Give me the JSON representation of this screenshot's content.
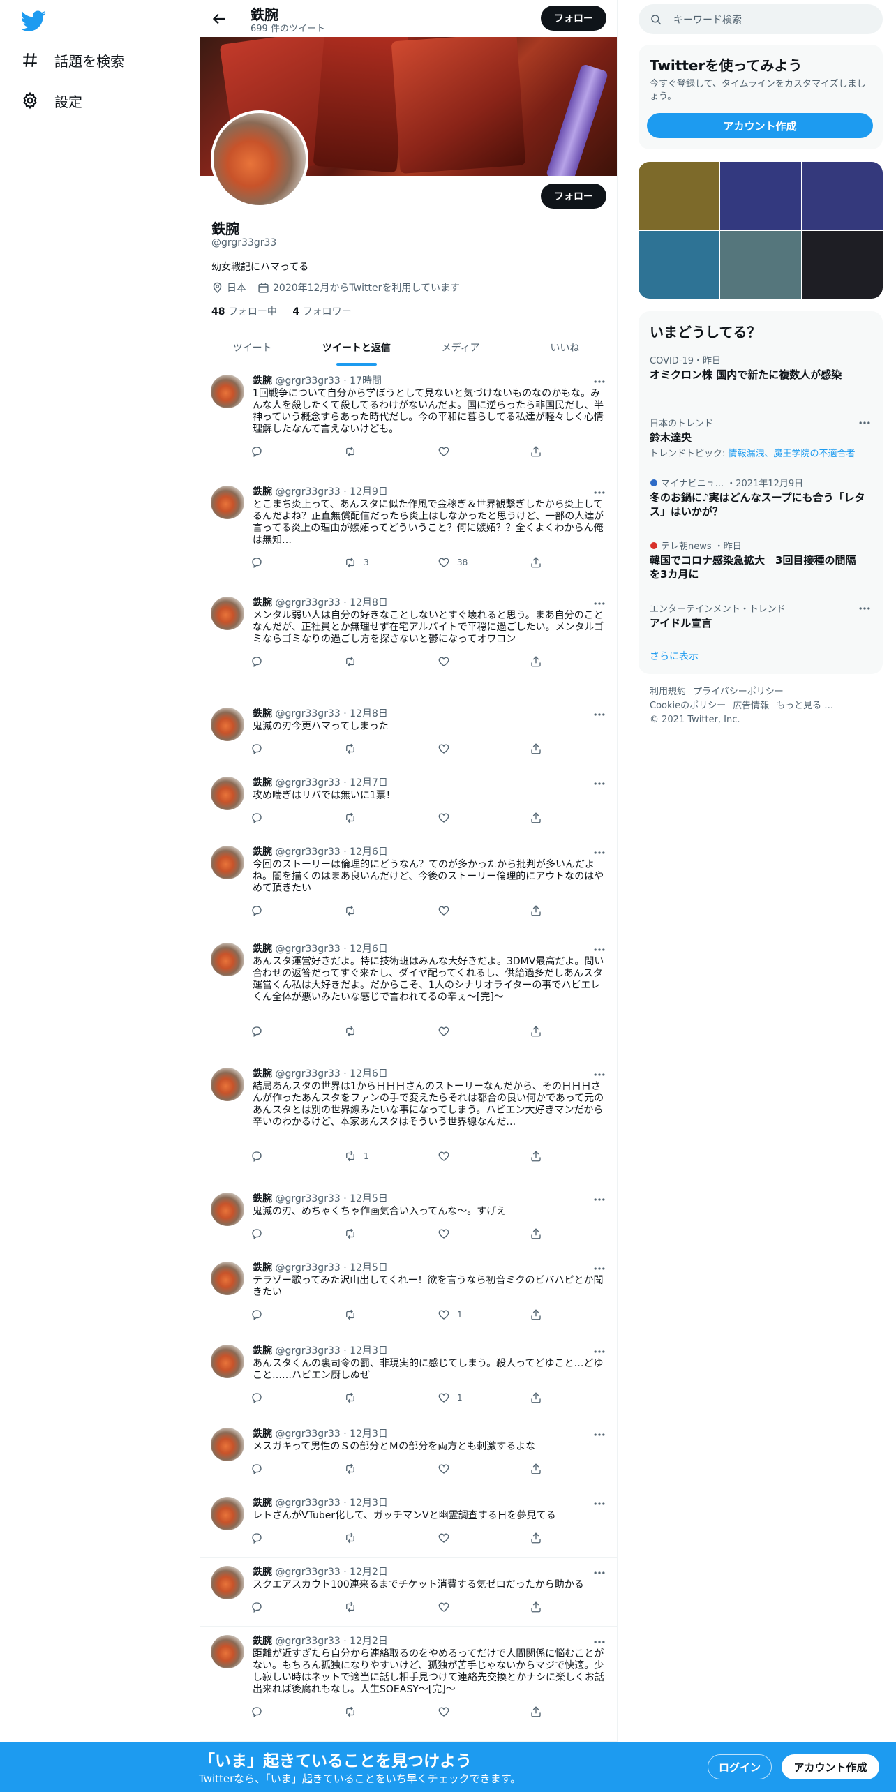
{
  "nav": {
    "items": [
      {
        "label": "話題を検索",
        "icon": "hashtag-icon"
      },
      {
        "label": "設定",
        "icon": "gear-icon"
      }
    ]
  },
  "header": {
    "title": "鉄腕",
    "tweet_count": "699 件のツイート",
    "follow_label": "フォロー"
  },
  "profile": {
    "name": "鉄腕",
    "handle": "@grgr33gr33",
    "bio": "幼女戦記にハマってる",
    "location": "日本",
    "joined": "2020年12月からTwitterを利用しています",
    "following_count": "48",
    "following_label": "フォロー中",
    "followers_count": "4",
    "followers_label": "フォロワー",
    "follow_label": "フォロー"
  },
  "tabs": [
    {
      "label": "ツイート",
      "active": false
    },
    {
      "label": "ツイートと返信",
      "active": true
    },
    {
      "label": "メディア",
      "active": false
    },
    {
      "label": "いいね",
      "active": false
    }
  ],
  "tweets": [
    {
      "name": "鉄腕",
      "handle": "@grgr33gr33",
      "time": "17時間",
      "text": "1回戦争について自分から学ぼうとして見ないと気づけないものなのかもな。みんな人を殺したくて殺してるわけがないんだよ。国に逆らったら非国民だし、半神っていう概念すらあった時代だし。今の平和に暮らしてる私達が軽々しく心情理解したなんて言えないけども。",
      "retweets": "",
      "likes": ""
    },
    {
      "name": "鉄腕",
      "handle": "@grgr33gr33",
      "time": "12月9日",
      "text": "とこまち炎上って、あんスタに似た作風で金稼ぎ＆世界観繋ぎしたから炎上してるんだよね？正直無償配信だったら炎上はしなかったと思うけど、一部の人達が言ってる炎上の理由が嫉妬ってどういうこと？何に嫉妬？？全くよくわからん俺は無知…",
      "retweets": "3",
      "likes": "38"
    },
    {
      "name": "鉄腕",
      "handle": "@grgr33gr33",
      "time": "12月8日",
      "text": "メンタル弱い人は自分の好きなことしないとすぐ壊れると思う。まあ自分のことなんだが、正社員とか無理せず在宅アルバイトで平穏に過ごしたい。メンタルゴミならゴミなりの過ごし方を探さないと鬱になってオワコン",
      "retweets": "",
      "likes": ""
    },
    {
      "name": "鉄腕",
      "handle": "@grgr33gr33",
      "time": "12月8日",
      "text": "鬼滅の刃今更ハマってしまった",
      "retweets": "",
      "likes": ""
    },
    {
      "name": "鉄腕",
      "handle": "@grgr33gr33",
      "time": "12月7日",
      "text": "攻め喘ぎはリバでは無いに1票！",
      "retweets": "",
      "likes": ""
    },
    {
      "name": "鉄腕",
      "handle": "@grgr33gr33",
      "time": "12月6日",
      "text": "今回のストーリーは倫理的にどうなん？てのが多かったから批判が多いんだよね。闇を描くのはまあ良いんだけど、今後のストーリー倫理的にアウトなのはやめて頂きたい",
      "retweets": "",
      "likes": ""
    },
    {
      "name": "鉄腕",
      "handle": "@grgr33gr33",
      "time": "12月6日",
      "text": "あんスタ運営好きだよ。特に技術班はみんな大好きだよ。3DMV最高だよ。問い合わせの返答だってすぐ来たし、ダイヤ配ってくれるし、供給過多だしあんスタ運営くん私は大好きだよ。だからこそ、1人のシナリオライターの事でハビエレくん全体が悪いみたいな感じで言われてるの辛ぇ〜[完]〜",
      "retweets": "",
      "likes": ""
    },
    {
      "name": "鉄腕",
      "handle": "@grgr33gr33",
      "time": "12月6日",
      "text": "結局あんスタの世界は1から日日日さんのストーリーなんだから、その日日日さんが作ったあんスタをファンの手で変えたらそれは都合の良い何かであって元のあんスタとは別の世界線みたいな事になってしまう。ハビエン大好きマンだから辛いのわかるけど、本家あんスタはそういう世界線なんだ…",
      "retweets": "1",
      "likes": ""
    },
    {
      "name": "鉄腕",
      "handle": "@grgr33gr33",
      "time": "12月5日",
      "text": "鬼滅の刃、めちゃくちゃ作画気合い入ってんな〜。すげえ",
      "retweets": "",
      "likes": ""
    },
    {
      "name": "鉄腕",
      "handle": "@grgr33gr33",
      "time": "12月5日",
      "text": "テラゾー歌ってみた沢山出してくれー！欲を言うなら初音ミクのビバハピとか聞きたい",
      "retweets": "",
      "likes": "1"
    },
    {
      "name": "鉄腕",
      "handle": "@grgr33gr33",
      "time": "12月3日",
      "text": "あんスタくんの裏司令の罰、非現実的に感じてしまう。殺人ってどゆこと…どゆこと……ハビエン厨しぬぜ",
      "retweets": "",
      "likes": "1"
    },
    {
      "name": "鉄腕",
      "handle": "@grgr33gr33",
      "time": "12月3日",
      "text": "メスガキって男性のＳの部分とＭの部分を両方とも刺激するよな",
      "retweets": "",
      "likes": ""
    },
    {
      "name": "鉄腕",
      "handle": "@grgr33gr33",
      "time": "12月3日",
      "text": "レトさんがVTuber化して、ガッチマンVと幽霊調査する日を夢見てる",
      "retweets": "",
      "likes": ""
    },
    {
      "name": "鉄腕",
      "handle": "@grgr33gr33",
      "time": "12月2日",
      "text": "スクエアスカウト100連来るまでチケット消費する気ゼロだったから助かる",
      "retweets": "",
      "likes": ""
    },
    {
      "name": "鉄腕",
      "handle": "@grgr33gr33",
      "time": "12月2日",
      "text": "距離が近すぎたら自分から連絡取るのをやめるってだけで人間関係に悩むことがない。もちろん孤独になりやすいけど、孤独が苦手じゃないからマジで快適。少し寂しい時はネットで適当に話し相手見つけて連絡先交換とかナシに楽しくお話出来れば後腐れもなし。人生SOEASY〜[完]〜",
      "retweets": "",
      "likes": ""
    }
  ],
  "sidebar": {
    "search_placeholder": "キーワード検索",
    "signup": {
      "title": "Twitterを使ってみよう",
      "subtitle": "今すぐ登録して、タイムラインをカスタマイズしましょう。",
      "button": "アカウント作成"
    },
    "media_colors": [
      "#7d6a2a",
      "#33397f",
      "#34397c",
      "#2e7395",
      "#55767c",
      "#1e1e24"
    ],
    "trends_title": "いまどうしてる？",
    "trends": [
      {
        "context": "COVID-19・昨日",
        "title": "オミクロン株 国内で新たに複数人が感染",
        "sub_prefix": "",
        "sub_link": ""
      },
      {
        "context": "日本のトレンド",
        "title": "鈴木達央",
        "sub_prefix": "トレンドトピック: ",
        "sub_link": "情報漏洩、魔王学院の不適合者"
      },
      {
        "context": "マイナビニュ... ・2021年12月9日",
        "title": "冬のお鍋に♪実はどんなスープにも合う「レタス」はいかが？",
        "sub_prefix": "",
        "sub_link": ""
      },
      {
        "context": "テレ朝news ・昨日",
        "title": "韓国でコロナ感染急拡大　3回目接種の間隔を3カ月に",
        "sub_prefix": "",
        "sub_link": ""
      },
      {
        "context": "エンターテインメント・トレンド",
        "title": "アイドル宣言",
        "sub_prefix": "",
        "sub_link": ""
      }
    ],
    "show_more": "さらに表示",
    "footer": {
      "line1": [
        "利用規約",
        "プライバシーポリシー"
      ],
      "line2": [
        "Cookieのポリシー",
        "広告情報",
        "もっと見る …"
      ],
      "copyright": "© 2021 Twitter, Inc."
    }
  },
  "bottom_bar": {
    "title": "「いま」起きていることを見つけよう",
    "subtitle": "Twitterなら、「いま」起きていることをいち早くチェックできます。",
    "login": "ログイン",
    "signup": "アカウント作成"
  },
  "colors": {
    "accent": "#1d9bf0",
    "text": "#0f1419",
    "muted": "#536471"
  }
}
